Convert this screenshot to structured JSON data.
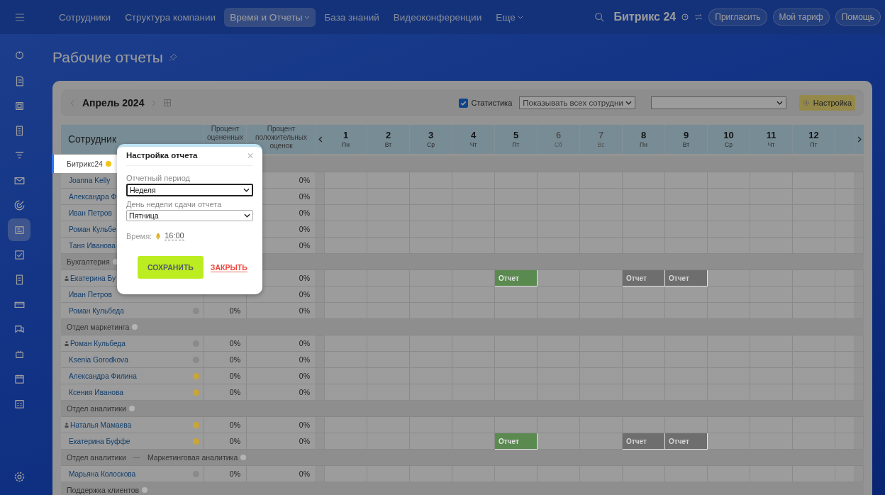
{
  "nav": {
    "items": [
      {
        "label": "Сотрудники",
        "selected": false,
        "dropdown": false
      },
      {
        "label": "Структура компании",
        "selected": false,
        "dropdown": false
      },
      {
        "label": "Время и Отчеты",
        "selected": true,
        "dropdown": true
      },
      {
        "label": "База знаний",
        "selected": false,
        "dropdown": false
      },
      {
        "label": "Видеоконференции",
        "selected": false,
        "dropdown": false
      },
      {
        "label": "Еще",
        "selected": false,
        "dropdown": true
      }
    ],
    "logo": "Битрикс 24",
    "buttons": [
      "Пригласить",
      "Мой тариф",
      "Помощь"
    ]
  },
  "sidebar": {
    "icons": [
      {
        "selected": false
      },
      {
        "selected": false
      },
      {
        "selected": false
      },
      {
        "selected": false
      },
      {
        "selected": false
      },
      {
        "selected": false
      },
      {
        "selected": false
      },
      {
        "selected": true
      },
      {
        "selected": false
      },
      {
        "selected": false
      },
      {
        "selected": false
      },
      {
        "selected": false
      },
      {
        "selected": false
      },
      {
        "selected": false
      },
      {
        "selected": false
      }
    ]
  },
  "page_title": "Рабочие отчеты",
  "toolbar": {
    "period": "Апрель 2024",
    "statistics": {
      "label": "Статистика",
      "checked": true
    },
    "filter": "Показывать всех сотрудни",
    "settings": "Настройка"
  },
  "table": {
    "columns": {
      "employee": "Сотрудник",
      "pct1": "Процент оцененных",
      "pct2": "Процент положительных оценок"
    },
    "days": [
      {
        "num": "1",
        "weekday": "Пн",
        "weekend": false
      },
      {
        "num": "2",
        "weekday": "Вт",
        "weekend": false
      },
      {
        "num": "3",
        "weekday": "Ср",
        "weekend": false
      },
      {
        "num": "4",
        "weekday": "Чт",
        "weekend": false
      },
      {
        "num": "5",
        "weekday": "Пт",
        "weekend": false
      },
      {
        "num": "6",
        "weekday": "Сб",
        "weekend": true
      },
      {
        "num": "7",
        "weekday": "Вс",
        "weekend": true
      },
      {
        "num": "8",
        "weekday": "Пн",
        "weekend": false
      },
      {
        "num": "9",
        "weekday": "Вт",
        "weekend": false
      },
      {
        "num": "10",
        "weekday": "Ср",
        "weekend": false
      },
      {
        "num": "11",
        "weekday": "Чт",
        "weekend": false
      },
      {
        "num": "12",
        "weekday": "Пт",
        "weekend": false
      }
    ],
    "rows": [
      {
        "kind": "group",
        "path": [
          "Битрикс24"
        ],
        "color": "#f0c419",
        "highlighted": true
      },
      {
        "kind": "employee",
        "name": "Joanna Kelly",
        "head": false,
        "pct2": "0%"
      },
      {
        "kind": "employee",
        "name": "Александра Ф",
        "head": false,
        "pct2": "0%"
      },
      {
        "kind": "employee",
        "name": "Иван Петров",
        "head": false,
        "pct2": "0%"
      },
      {
        "kind": "employee",
        "name": "Роман Кульбе",
        "head": false,
        "pct2": "0%"
      },
      {
        "kind": "employee",
        "name": "Таня Иванова",
        "head": false,
        "pct2": "0%"
      },
      {
        "kind": "group",
        "path": [
          "Бухгалтерия"
        ],
        "color": "#b4b4b4",
        "highlighted": false
      },
      {
        "kind": "employee",
        "name": "Екатерина Бу",
        "head": true,
        "pct2": "0%",
        "days": [
          {
            "kind": "none"
          },
          {
            "kind": "none"
          },
          {
            "kind": "none"
          },
          {
            "kind": "none"
          },
          {
            "text": "Отчет",
            "kind": "done"
          },
          {
            "kind": "none"
          },
          {
            "kind": "none"
          },
          {
            "text": "Отчет",
            "kind": "pending"
          },
          {
            "text": "Отчет",
            "kind": "pending"
          },
          {
            "kind": "none"
          },
          {
            "kind": "none"
          },
          {
            "kind": "none"
          }
        ]
      },
      {
        "kind": "employee",
        "name": "Иван Петров",
        "head": false,
        "pct2": "0%"
      },
      {
        "kind": "employee",
        "name": "Роман Кульбеда",
        "head": false,
        "color": "#8a8a8a",
        "pct1": "0%",
        "pct2": "0%"
      },
      {
        "kind": "group",
        "path": [
          "Отдел маркетинга"
        ],
        "color": "#b4b4b4",
        "highlighted": false
      },
      {
        "kind": "employee",
        "name": "Роман Кульбеда",
        "head": true,
        "color": "#8a8a8a",
        "pct1": "0%",
        "pct2": "0%"
      },
      {
        "kind": "employee",
        "name": "Ksenia Gorodkova",
        "head": false,
        "color": "#8a8a8a",
        "pct1": "0%",
        "pct2": "0%"
      },
      {
        "kind": "employee",
        "name": "Александра Филина",
        "head": false,
        "color": "#c9a437",
        "pct1": "0%",
        "pct2": "0%"
      },
      {
        "kind": "employee",
        "name": "Ксения Иванова",
        "head": false,
        "color": "#c9a437",
        "pct1": "0%",
        "pct2": "0%"
      },
      {
        "kind": "group",
        "path": [
          "Отдел аналитики"
        ],
        "color": "#b4b4b4",
        "highlighted": false
      },
      {
        "kind": "employee",
        "name": "Наталья Мамаева",
        "head": true,
        "color": "#c9a437",
        "pct1": "0%",
        "pct2": "0%"
      },
      {
        "kind": "employee",
        "name": "Екатерина Буффе",
        "head": false,
        "color": "#c9a437",
        "pct1": "0%",
        "pct2": "0%",
        "days": [
          {
            "kind": "none"
          },
          {
            "kind": "none"
          },
          {
            "kind": "none"
          },
          {
            "kind": "none"
          },
          {
            "text": "Отчет",
            "kind": "done"
          },
          {
            "kind": "none"
          },
          {
            "kind": "none"
          },
          {
            "text": "Отчет",
            "kind": "pending"
          },
          {
            "text": "Отчет",
            "kind": "pending"
          },
          {
            "kind": "none"
          },
          {
            "kind": "none"
          },
          {
            "kind": "none"
          }
        ]
      },
      {
        "kind": "group",
        "path": [
          "Отдел аналитики",
          "Маркетинговая аналитика"
        ],
        "color": "#b4b4b4",
        "highlighted": false
      },
      {
        "kind": "employee",
        "name": "Марьяна Колоскова",
        "head": false,
        "color": "#8a8a8a",
        "pct1": "0%",
        "pct2": "0%"
      },
      {
        "kind": "group",
        "path": [
          "Поддержка клиентов"
        ],
        "color": "#b4b4b4",
        "highlighted": false
      }
    ]
  },
  "dialog": {
    "title": "Настройка отчета",
    "fields": [
      {
        "label": "Отчетный период",
        "value": "Неделя",
        "focused": true
      },
      {
        "label": "День недели сдачи отчета",
        "value": "Пятница",
        "focused": false
      }
    ],
    "time_label": "Время:",
    "time": "16:00",
    "save": "СОХРАНИТЬ",
    "close": "ЗАКРЫТЬ"
  }
}
